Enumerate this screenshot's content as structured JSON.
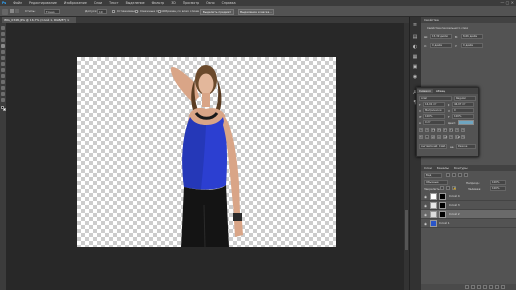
{
  "menubar": {
    "logo": "Ps",
    "items": [
      "Файл",
      "Редактирование",
      "Изображение",
      "Слои",
      "Текст",
      "Выделение",
      "Фильтр",
      "3D",
      "Просмотр",
      "Окно",
      "Справка"
    ],
    "window_controls": "—  ▢  ✕"
  },
  "options": {
    "mode_label": "Новое выделение",
    "style_label": "Стиль:",
    "style_value": "Точно",
    "feather_label": "Допуск:",
    "feather_value": "10",
    "antialias_label": "Сглаживание",
    "contiguous_label": "Смежные пикс.",
    "sample_label": "Образец со всех слоев",
    "select_subject": "Выделить предмет",
    "select_and_mask": "Выделение и маска..."
  },
  "document": {
    "tab_title": "IMG_0348.JPG @ 16,7% (Слой 1, RGB/8*) ×"
  },
  "properties": {
    "title": "Свойства",
    "subtitle": "Свойства пиксельного слоя",
    "w_label": "Ш:",
    "w_value": "15,39 дюйм",
    "h_label": "В:",
    "h_value": "8,66 дюйм",
    "x_label": "X:",
    "x_value": "0 дюйм",
    "y_label": "Y:",
    "y_value": "0 дюйм"
  },
  "character": {
    "tabs": [
      "Символ",
      "Абзац"
    ],
    "font_family": "Arial",
    "font_style": "Regular",
    "font_size": "16,01 пт",
    "leading": "46,07 пт",
    "kerning": "Метрически",
    "tracking": "0",
    "vscale": "100%",
    "hscale": "100%",
    "baseline": "0 пт",
    "color_label": "Цвет:",
    "styles_row": [
      "T",
      "T",
      "TT",
      "Tt",
      "T¹",
      "T₁",
      "T",
      "T"
    ],
    "opentype_row": [
      "fi",
      "ℴ",
      "st",
      "A",
      "ad",
      "T",
      "1st",
      "½"
    ],
    "language": "Английский: США",
    "aa_label": "aa",
    "aa_value": "Резкое"
  },
  "layers": {
    "tabs": [
      "Слои",
      "Каналы",
      "Контуры"
    ],
    "search_kind": "Вид",
    "blend_mode": "Обычные",
    "opacity_label": "Непрозр.:",
    "opacity_value": "100%",
    "lock_label": "Закрепить:",
    "fill_label": "Заливка:",
    "fill_value": "100%",
    "items": [
      {
        "name": "Слой 4",
        "visible": true,
        "thumb": "#ffffff",
        "mask": true,
        "selected": false
      },
      {
        "name": "Слой 3",
        "visible": true,
        "thumb": "#e8e8e8",
        "mask": true,
        "selected": false
      },
      {
        "name": "Слой 2",
        "visible": true,
        "thumb": "#dcdcdc",
        "mask": true,
        "selected": true
      },
      {
        "name": "Слой 1",
        "visible": true,
        "thumb": "#2a55c8",
        "mask": false,
        "selected": false
      }
    ]
  },
  "icons": [
    "move-icon",
    "marquee-icon",
    "lasso-icon",
    "magic-wand-icon",
    "crop-icon",
    "eyedropper-icon",
    "brush-icon",
    "stamp-icon",
    "eraser-icon",
    "gradient-icon",
    "text-icon",
    "hand-icon",
    "zoom-icon"
  ],
  "colors": {
    "accent": "#31a8ff",
    "panel": "#535353",
    "workspace": "#282828"
  }
}
